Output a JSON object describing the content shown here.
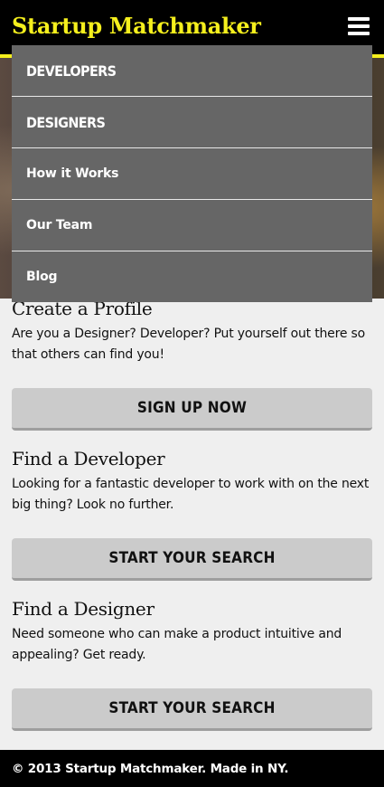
{
  "header": {
    "brand": "Startup Matchmaker",
    "menu_icon": "hamburger-menu-icon"
  },
  "nav": {
    "items": [
      {
        "label": "DEVELOPERS"
      },
      {
        "label": "DESIGNERS"
      },
      {
        "label": "How it Works"
      },
      {
        "label": "Our Team"
      },
      {
        "label": "Blog"
      }
    ]
  },
  "sections": [
    {
      "title": "Create a Profile",
      "text": "Are you a Designer? Developer? Put yourself out there so that others can find you!",
      "button": "SIGN UP NOW"
    },
    {
      "title": "Find a Developer",
      "text": "Looking for a fantastic developer to work with on the next big thing? Look no further.",
      "button": "START YOUR SEARCH"
    },
    {
      "title": "Find a Designer",
      "text": "Need someone who can make a product intuitive and appealing? Get ready.",
      "button": "START YOUR SEARCH"
    }
  ],
  "footer": {
    "text": "© 2013 Startup Matchmaker. Made in NY."
  },
  "colors": {
    "brand_yellow": "#f5ef1d",
    "menu_bg": "#666666",
    "button_bg": "#cbcbcb"
  }
}
